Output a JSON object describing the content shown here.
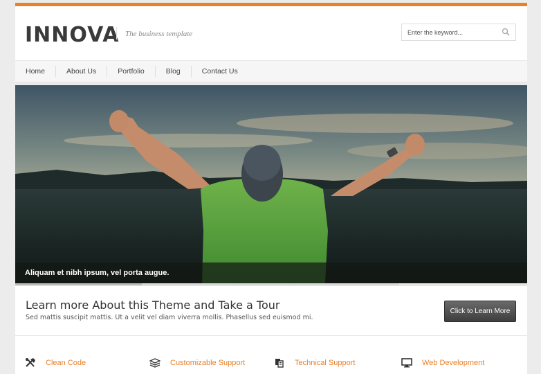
{
  "brand": {
    "logo": "INNOVA",
    "tagline": "The business template",
    "accent": "#e8812a"
  },
  "search": {
    "placeholder": "Enter the keyword...",
    "icon": "search-icon"
  },
  "nav": {
    "items": [
      {
        "label": "Home"
      },
      {
        "label": "About Us"
      },
      {
        "label": "Portfolio"
      },
      {
        "label": "Blog"
      },
      {
        "label": "Contact Us"
      }
    ]
  },
  "slider": {
    "caption": "Aliquam et nibh ipsum, vel porta augue.",
    "progress": 0.33
  },
  "tour": {
    "title": "Learn more About this Theme and Take a Tour",
    "description": "Sed mattis suscipit mattis. Ut a velit vel diam viverra mollis. Phasellus sed euismod mi.",
    "button": "Click to Learn More"
  },
  "features": [
    {
      "label": "Clean Code",
      "icon": "tools-icon"
    },
    {
      "label": "Customizable Support",
      "icon": "layers-icon"
    },
    {
      "label": "Technical Support",
      "icon": "documents-icon"
    },
    {
      "label": "Web Development",
      "icon": "monitor-icon"
    }
  ]
}
